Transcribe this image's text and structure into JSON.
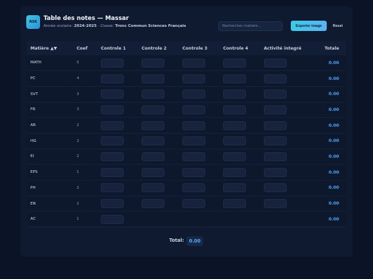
{
  "header": {
    "logo_text": "RSK",
    "title": "Table des notes — Massar",
    "subtitle_prefix": "Année scolaire:",
    "year": "2024-2025",
    "class_prefix": "· Classe:",
    "class_name": "Tronc Commun Sciences Français",
    "search_placeholder": "Rechercher matière...",
    "export_label": "Exporter image",
    "reset_label": "Reset"
  },
  "table": {
    "columns": [
      "Matière ▲▼",
      "Coef",
      "Controle 1",
      "Controle 2",
      "Controle 3",
      "Controle 4",
      "Activité integré",
      "Totale"
    ],
    "rows": [
      {
        "subject": "MATH",
        "coef": "5",
        "inputs": 5,
        "total": "0.00"
      },
      {
        "subject": "PC",
        "coef": "4",
        "inputs": 5,
        "total": "0.00"
      },
      {
        "subject": "SVT",
        "coef": "3",
        "inputs": 5,
        "total": "0.00"
      },
      {
        "subject": "FR",
        "coef": "3",
        "inputs": 5,
        "total": "0.00"
      },
      {
        "subject": "AR",
        "coef": "2",
        "inputs": 5,
        "total": "0.00"
      },
      {
        "subject": "HG",
        "coef": "2",
        "inputs": 5,
        "total": "0.00"
      },
      {
        "subject": "EI",
        "coef": "2",
        "inputs": 5,
        "total": "0.00"
      },
      {
        "subject": "EPS",
        "coef": "1",
        "inputs": 5,
        "total": "0.00"
      },
      {
        "subject": "PH",
        "coef": "2",
        "inputs": 5,
        "total": "0.00"
      },
      {
        "subject": "EN",
        "coef": "2",
        "inputs": 5,
        "total": "0.00"
      },
      {
        "subject": "AC",
        "coef": "1",
        "inputs": 1,
        "total": "0.00"
      }
    ]
  },
  "footer": {
    "total_label": "Total:",
    "total_value": "0.00"
  },
  "colors": {
    "background": "#0b1426",
    "card": "#0f1a30",
    "accent": "#3ec9e6",
    "total_text": "#4da3ff"
  }
}
